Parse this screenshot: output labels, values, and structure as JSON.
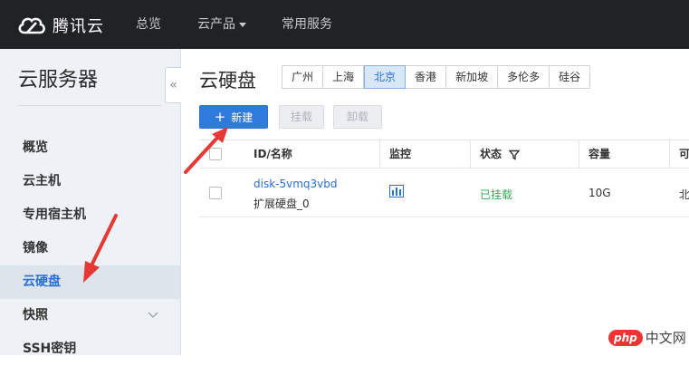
{
  "header": {
    "brand": "腾讯云",
    "nav": [
      {
        "label": "总览"
      },
      {
        "label": "云产品"
      },
      {
        "label": "常用服务"
      }
    ]
  },
  "sidebar": {
    "title": "云服务器",
    "collapse_icon": "«",
    "items": [
      {
        "label": "概览"
      },
      {
        "label": "云主机"
      },
      {
        "label": "专用宿主机"
      },
      {
        "label": "镜像"
      },
      {
        "label": "云硬盘"
      },
      {
        "label": "快照"
      },
      {
        "label": "SSH密钥"
      }
    ]
  },
  "main": {
    "title": "云硬盘",
    "regions": [
      "广州",
      "上海",
      "北京",
      "香港",
      "新加坡",
      "多伦多",
      "硅谷"
    ],
    "selected_region": "北京",
    "toolbar": {
      "new_label": "新建",
      "mount_label": "挂载",
      "unmount_label": "卸载"
    },
    "table": {
      "headers": [
        "ID/名称",
        "监控",
        "状态",
        "容量",
        "可"
      ],
      "rows": [
        {
          "id": "disk-5vmq3vbd",
          "name": "扩展硬盘_0",
          "status": "已挂载",
          "capacity": "10G",
          "extra": "北"
        }
      ]
    }
  },
  "watermark": {
    "badge": "php",
    "text": "中文网"
  },
  "colors": {
    "topbar": "#202226",
    "accent": "#2f7bdc",
    "status_ok": "#3aa657",
    "arrow": "#e53935"
  }
}
